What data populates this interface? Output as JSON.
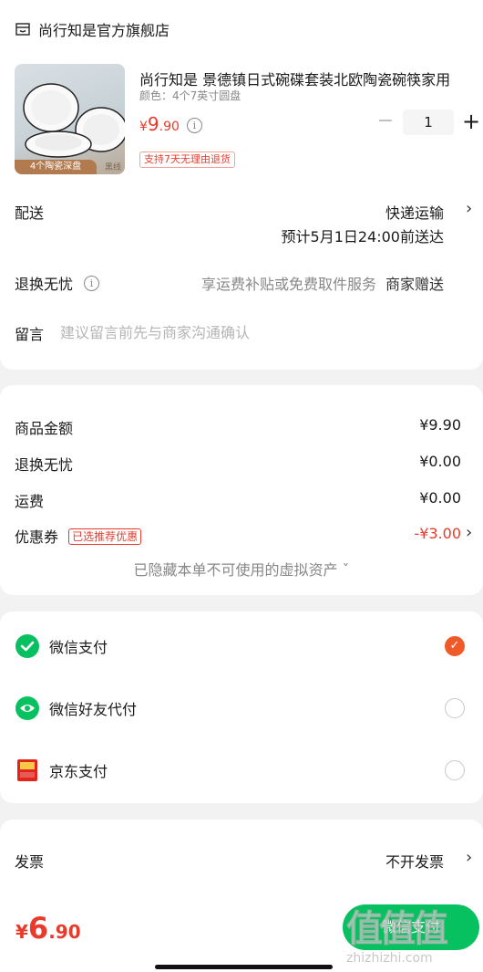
{
  "store": {
    "name": "尚行知是官方旗舰店",
    "icon": "store-icon"
  },
  "product": {
    "title": "尚行知是 景德镇日式碗碟套装北欧陶瓷碗筷家用",
    "spec": "颜色：4个7英寸圆盘",
    "price_currency": "¥",
    "price_int": "9",
    "price_dec": ".90",
    "thumb_tag": "4个陶瓷深盘",
    "thumb_tag2": "黑线",
    "return_badge": "支持7天无理由退货",
    "quantity": "1",
    "minus": "−",
    "plus": "+"
  },
  "delivery": {
    "label": "配送",
    "method": "快递运输",
    "eta": "预计5月1日24:00前送达"
  },
  "returns": {
    "label": "退换无忧",
    "info": "i",
    "desc": "享运费补贴或免费取件服务",
    "seller": "商家赠送"
  },
  "message": {
    "label": "留言",
    "placeholder": "建议留言前先与商家沟通确认"
  },
  "summary": {
    "goods_label": "商品金额",
    "goods_value": "¥9.90",
    "returns_label": "退换无忧",
    "returns_value": "¥0.00",
    "shipping_label": "运费",
    "shipping_value": "¥0.00",
    "coupon_label": "优惠券",
    "coupon_tag": "已选推荐优惠",
    "coupon_value": "-¥3.00",
    "hidden_assets": "已隐藏本单不可使用的虚拟资产 ˇ"
  },
  "payment": [
    {
      "name": "微信支付",
      "icon": "wechat-pay-icon",
      "selected": true
    },
    {
      "name": "微信好友代付",
      "icon": "wechat-friend-pay-icon",
      "selected": false
    },
    {
      "name": "京东支付",
      "icon": "jd-pay-icon",
      "selected": false
    }
  ],
  "invoice": {
    "label": "发票",
    "value": "不开发票"
  },
  "chevron": "›",
  "checkmark": "✓",
  "footer": {
    "total_currency": "¥",
    "total_int": "6",
    "total_dec": ".90",
    "pay_button": "微信支付",
    "watermark_big": "值值值",
    "watermark": "zhizhizhi.com"
  },
  "colors": {
    "accent": "#e93b2c",
    "wechat": "#07c160",
    "radio_on": "#f05a28"
  }
}
